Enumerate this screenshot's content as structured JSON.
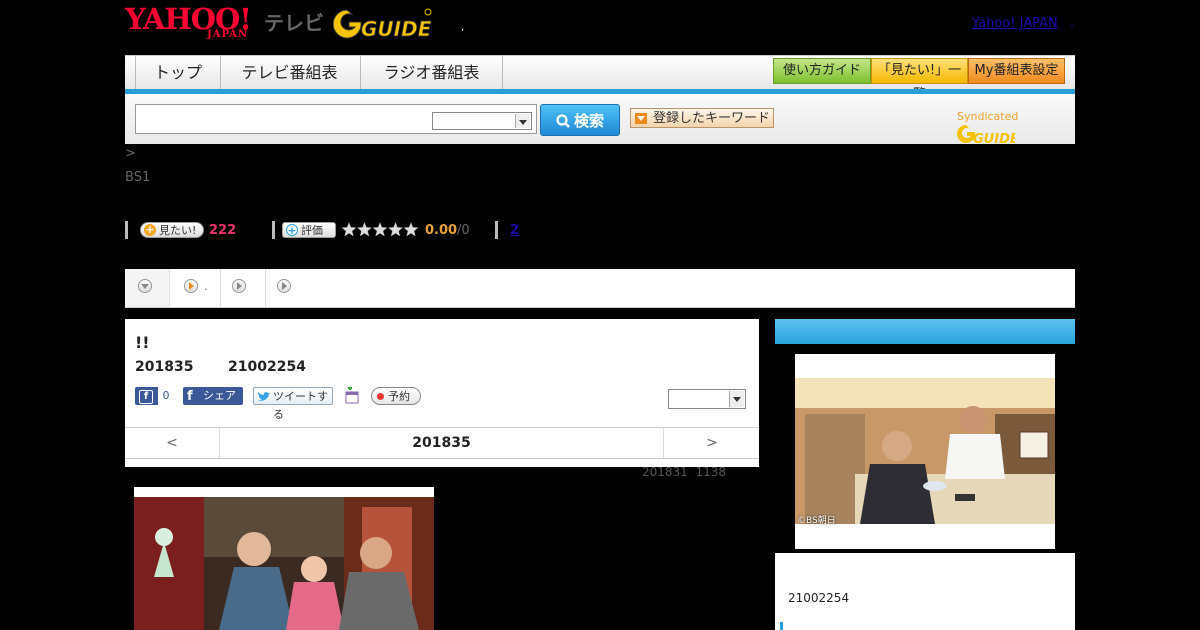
{
  "header": {
    "yahoo_logo": "YAHOO!",
    "yahoo_logo_sub": "JAPAN",
    "tv_label": "テレビ",
    "gguide_logo": "G GUIDE",
    "top_link": "Yahoo! JAPAN",
    "top_link_dot": ".",
    "dot": ","
  },
  "nav": {
    "tabs": [
      "トップ",
      "テレビ番組表",
      "ラジオ番組表"
    ],
    "buttons": [
      "使い方ガイド",
      "「見たい!」一覧",
      "My番組表設定"
    ]
  },
  "search": {
    "input_value": "",
    "select_value": "",
    "button_label": "検索",
    "keyword_button": "登録したキーワード",
    "syndicated": "Syndicated"
  },
  "breadcrumb": ">",
  "channel": "BS1",
  "ratings": {
    "want_label": "見たい!",
    "want_count": "222",
    "rate_label": "評価",
    "stars": 0,
    "stars_max": 5,
    "score": "0.00",
    "score_suffix": "/0",
    "link": "2"
  },
  "tabs": [
    {
      "icon": "chevron-down-icon",
      "label": ""
    },
    {
      "icon": "play-icon",
      "label": "."
    },
    {
      "icon": "play-icon",
      "label": ""
    },
    {
      "icon": "play-icon",
      "label": ""
    }
  ],
  "program": {
    "title": "!!",
    "date": "201835",
    "id": "21002254",
    "fb_like_count": "0",
    "fb_share": "シェア",
    "tweet": "ツイートする",
    "reserve": "予約",
    "select_value": "",
    "pager_prev": "<",
    "pager_current": "201835",
    "pager_next": ">",
    "updated": "201831  1138"
  },
  "right": {
    "photo_credit": "©BS朝日",
    "id": "21002254"
  },
  "colors": {
    "accent": "#2a9fd6",
    "want_count": "#e8336d",
    "score": "#e8a23d",
    "brand_red": "#ff0033"
  }
}
